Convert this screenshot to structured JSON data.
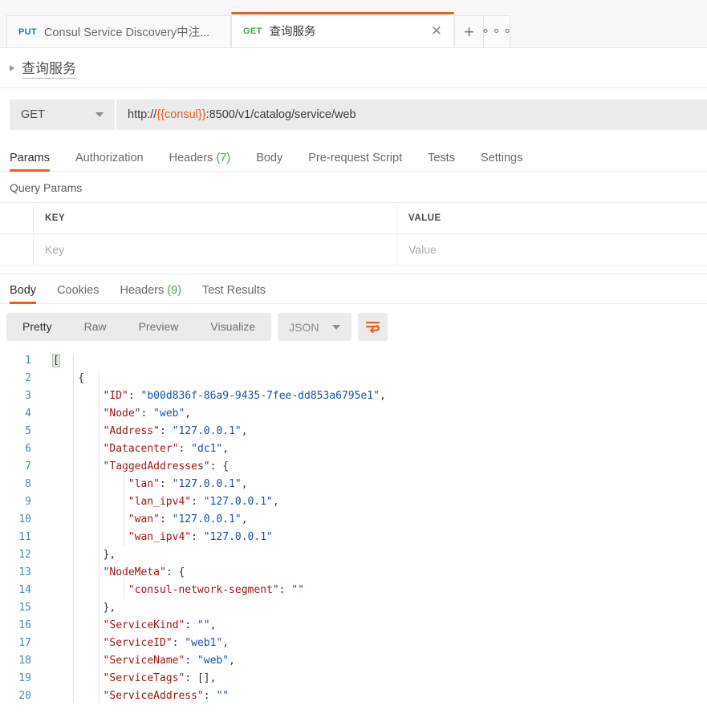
{
  "window": {
    "tabs": [
      {
        "method": "PUT",
        "method_class": "m-put",
        "name": "Consul Service Discovery中注...",
        "active": false
      },
      {
        "method": "GET",
        "method_class": "m-get",
        "name": "查询服务",
        "active": true
      }
    ],
    "new_tab_icon": "plus-icon",
    "more_icon": "ellipsis-icon",
    "close_icon": "close-icon"
  },
  "breadcrumb": {
    "title": "查询服务",
    "triangle_icon": "chevron-right-icon"
  },
  "request": {
    "method": "GET",
    "url_prefix": "http://",
    "url_variable": "{{consul}}",
    "url_suffix": ":8500/v1/catalog/service/web",
    "url_full": "http://{{consul}}:8500/v1/catalog/service/web",
    "tabs": [
      {
        "label": "Params",
        "count": "",
        "active": true
      },
      {
        "label": "Authorization",
        "count": "",
        "active": false
      },
      {
        "label": "Headers",
        "count": "(7)",
        "active": false
      },
      {
        "label": "Body",
        "count": "",
        "active": false
      },
      {
        "label": "Pre-request Script",
        "count": "",
        "active": false
      },
      {
        "label": "Tests",
        "count": "",
        "active": false
      },
      {
        "label": "Settings",
        "count": "",
        "active": false
      }
    ],
    "query_params_label": "Query Params",
    "params_table": {
      "headers": [
        "KEY",
        "VALUE"
      ],
      "rows": [
        {
          "key": "Key",
          "value": "Value"
        }
      ]
    }
  },
  "response": {
    "tabs": [
      {
        "label": "Body",
        "count": "",
        "active": true
      },
      {
        "label": "Cookies",
        "count": "",
        "active": false
      },
      {
        "label": "Headers",
        "count": "(9)",
        "active": false
      },
      {
        "label": "Test Results",
        "count": "",
        "active": false
      }
    ],
    "view_modes": [
      {
        "label": "Pretty",
        "active": true
      },
      {
        "label": "Raw",
        "active": false
      },
      {
        "label": "Preview",
        "active": false
      },
      {
        "label": "Visualize",
        "active": false
      }
    ],
    "format": "JSON",
    "format_caret_icon": "chevron-down-icon",
    "wrap_icon": "wrap-text-icon",
    "wrap_icon_color": "#ef5b25",
    "body_lines": [
      {
        "n": "1",
        "ind": 0,
        "tokens": [
          {
            "t": "[",
            "c": "brkt-hl"
          }
        ]
      },
      {
        "n": "2",
        "ind": 1,
        "tokens": [
          {
            "t": "{",
            "c": "p"
          }
        ]
      },
      {
        "n": "3",
        "ind": 2,
        "tokens": [
          {
            "t": "\"ID\"",
            "c": "k"
          },
          {
            "t": ": ",
            "c": "p"
          },
          {
            "t": "\"b00d836f-86a9-9435-7fee-dd853a6795e1\"",
            "c": "s"
          },
          {
            "t": ",",
            "c": "p"
          }
        ]
      },
      {
        "n": "4",
        "ind": 2,
        "tokens": [
          {
            "t": "\"Node\"",
            "c": "k"
          },
          {
            "t": ": ",
            "c": "p"
          },
          {
            "t": "\"web\"",
            "c": "s"
          },
          {
            "t": ",",
            "c": "p"
          }
        ]
      },
      {
        "n": "5",
        "ind": 2,
        "tokens": [
          {
            "t": "\"Address\"",
            "c": "k"
          },
          {
            "t": ": ",
            "c": "p"
          },
          {
            "t": "\"127.0.0.1\"",
            "c": "s"
          },
          {
            "t": ",",
            "c": "p"
          }
        ]
      },
      {
        "n": "6",
        "ind": 2,
        "tokens": [
          {
            "t": "\"Datacenter\"",
            "c": "k"
          },
          {
            "t": ": ",
            "c": "p"
          },
          {
            "t": "\"dc1\"",
            "c": "s"
          },
          {
            "t": ",",
            "c": "p"
          }
        ]
      },
      {
        "n": "7",
        "ind": 2,
        "tokens": [
          {
            "t": "\"TaggedAddresses\"",
            "c": "k"
          },
          {
            "t": ": {",
            "c": "p"
          }
        ]
      },
      {
        "n": "8",
        "ind": 3,
        "tokens": [
          {
            "t": "\"lan\"",
            "c": "k"
          },
          {
            "t": ": ",
            "c": "p"
          },
          {
            "t": "\"127.0.0.1\"",
            "c": "s"
          },
          {
            "t": ",",
            "c": "p"
          }
        ]
      },
      {
        "n": "9",
        "ind": 3,
        "tokens": [
          {
            "t": "\"lan_ipv4\"",
            "c": "k"
          },
          {
            "t": ": ",
            "c": "p"
          },
          {
            "t": "\"127.0.0.1\"",
            "c": "s"
          },
          {
            "t": ",",
            "c": "p"
          }
        ]
      },
      {
        "n": "10",
        "ind": 3,
        "tokens": [
          {
            "t": "\"wan\"",
            "c": "k"
          },
          {
            "t": ": ",
            "c": "p"
          },
          {
            "t": "\"127.0.0.1\"",
            "c": "s"
          },
          {
            "t": ",",
            "c": "p"
          }
        ]
      },
      {
        "n": "11",
        "ind": 3,
        "tokens": [
          {
            "t": "\"wan_ipv4\"",
            "c": "k"
          },
          {
            "t": ": ",
            "c": "p"
          },
          {
            "t": "\"127.0.0.1\"",
            "c": "s"
          }
        ]
      },
      {
        "n": "12",
        "ind": 2,
        "tokens": [
          {
            "t": "},",
            "c": "p"
          }
        ]
      },
      {
        "n": "13",
        "ind": 2,
        "tokens": [
          {
            "t": "\"NodeMeta\"",
            "c": "k"
          },
          {
            "t": ": {",
            "c": "p"
          }
        ]
      },
      {
        "n": "14",
        "ind": 3,
        "tokens": [
          {
            "t": "\"consul-network-segment\"",
            "c": "k"
          },
          {
            "t": ": ",
            "c": "p"
          },
          {
            "t": "\"\"",
            "c": "s"
          }
        ]
      },
      {
        "n": "15",
        "ind": 2,
        "tokens": [
          {
            "t": "},",
            "c": "p"
          }
        ]
      },
      {
        "n": "16",
        "ind": 2,
        "tokens": [
          {
            "t": "\"ServiceKind\"",
            "c": "k"
          },
          {
            "t": ": ",
            "c": "p"
          },
          {
            "t": "\"\"",
            "c": "s"
          },
          {
            "t": ",",
            "c": "p"
          }
        ]
      },
      {
        "n": "17",
        "ind": 2,
        "tokens": [
          {
            "t": "\"ServiceID\"",
            "c": "k"
          },
          {
            "t": ": ",
            "c": "p"
          },
          {
            "t": "\"web1\"",
            "c": "s"
          },
          {
            "t": ",",
            "c": "p"
          }
        ]
      },
      {
        "n": "18",
        "ind": 2,
        "tokens": [
          {
            "t": "\"ServiceName\"",
            "c": "k"
          },
          {
            "t": ": ",
            "c": "p"
          },
          {
            "t": "\"web\"",
            "c": "s"
          },
          {
            "t": ",",
            "c": "p"
          }
        ]
      },
      {
        "n": "19",
        "ind": 2,
        "tokens": [
          {
            "t": "\"ServiceTags\"",
            "c": "k"
          },
          {
            "t": ": [],",
            "c": "p"
          }
        ]
      },
      {
        "n": "20",
        "ind": 2,
        "tokens": [
          {
            "t": "\"ServiceAddress\"",
            "c": "k"
          },
          {
            "t": ": ",
            "c": "p"
          },
          {
            "t": "\"\"",
            "c": "s"
          }
        ]
      }
    ]
  },
  "colors": {
    "accent": "#ef5b25",
    "get": "#3dab49",
    "put": "#0f7ec4",
    "json_key": "#a31515",
    "json_string": "#1a4fb4",
    "gutter": "#4a8ab0"
  }
}
